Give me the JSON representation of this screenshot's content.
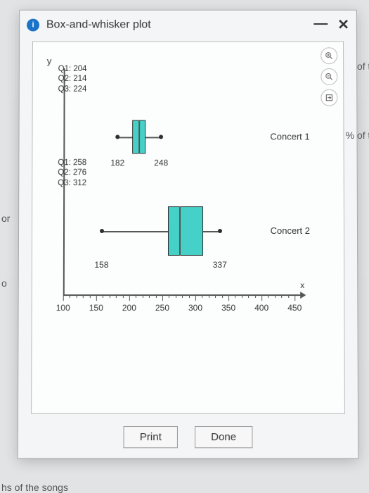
{
  "dialog": {
    "badge": "i",
    "title": "Box-and-whisker plot",
    "minimize": "—",
    "close": "✕",
    "print": "Print",
    "done": "Done",
    "tools": {
      "zoom_in": "zoom-in",
      "zoom_out": "zoom-out",
      "expand": "expand"
    }
  },
  "underlay": {
    "left_mid": "or",
    "left_low": "o",
    "bottom": "hs of the songs",
    "right_top": "of the",
    "right_mid": "% of the"
  },
  "chart_data": {
    "type": "boxplot",
    "title": "",
    "xlabel": "x",
    "ylabel": "y",
    "xlim": [
      100,
      450
    ],
    "xticks_major": [
      100,
      150,
      200,
      250,
      300,
      350,
      400,
      450
    ],
    "series": [
      {
        "name": "Concert 1",
        "min": 182,
        "q1": 204,
        "median": 214,
        "q3": 224,
        "max": 248,
        "stats_label": "Q1: 204\nQ2: 214\nQ3: 224"
      },
      {
        "name": "Concert 2",
        "min": 158,
        "q1": 258,
        "median": 276,
        "q3": 312,
        "max": 337,
        "stats_label": "Q1: 258\nQ2: 276\nQ3: 312"
      }
    ]
  }
}
